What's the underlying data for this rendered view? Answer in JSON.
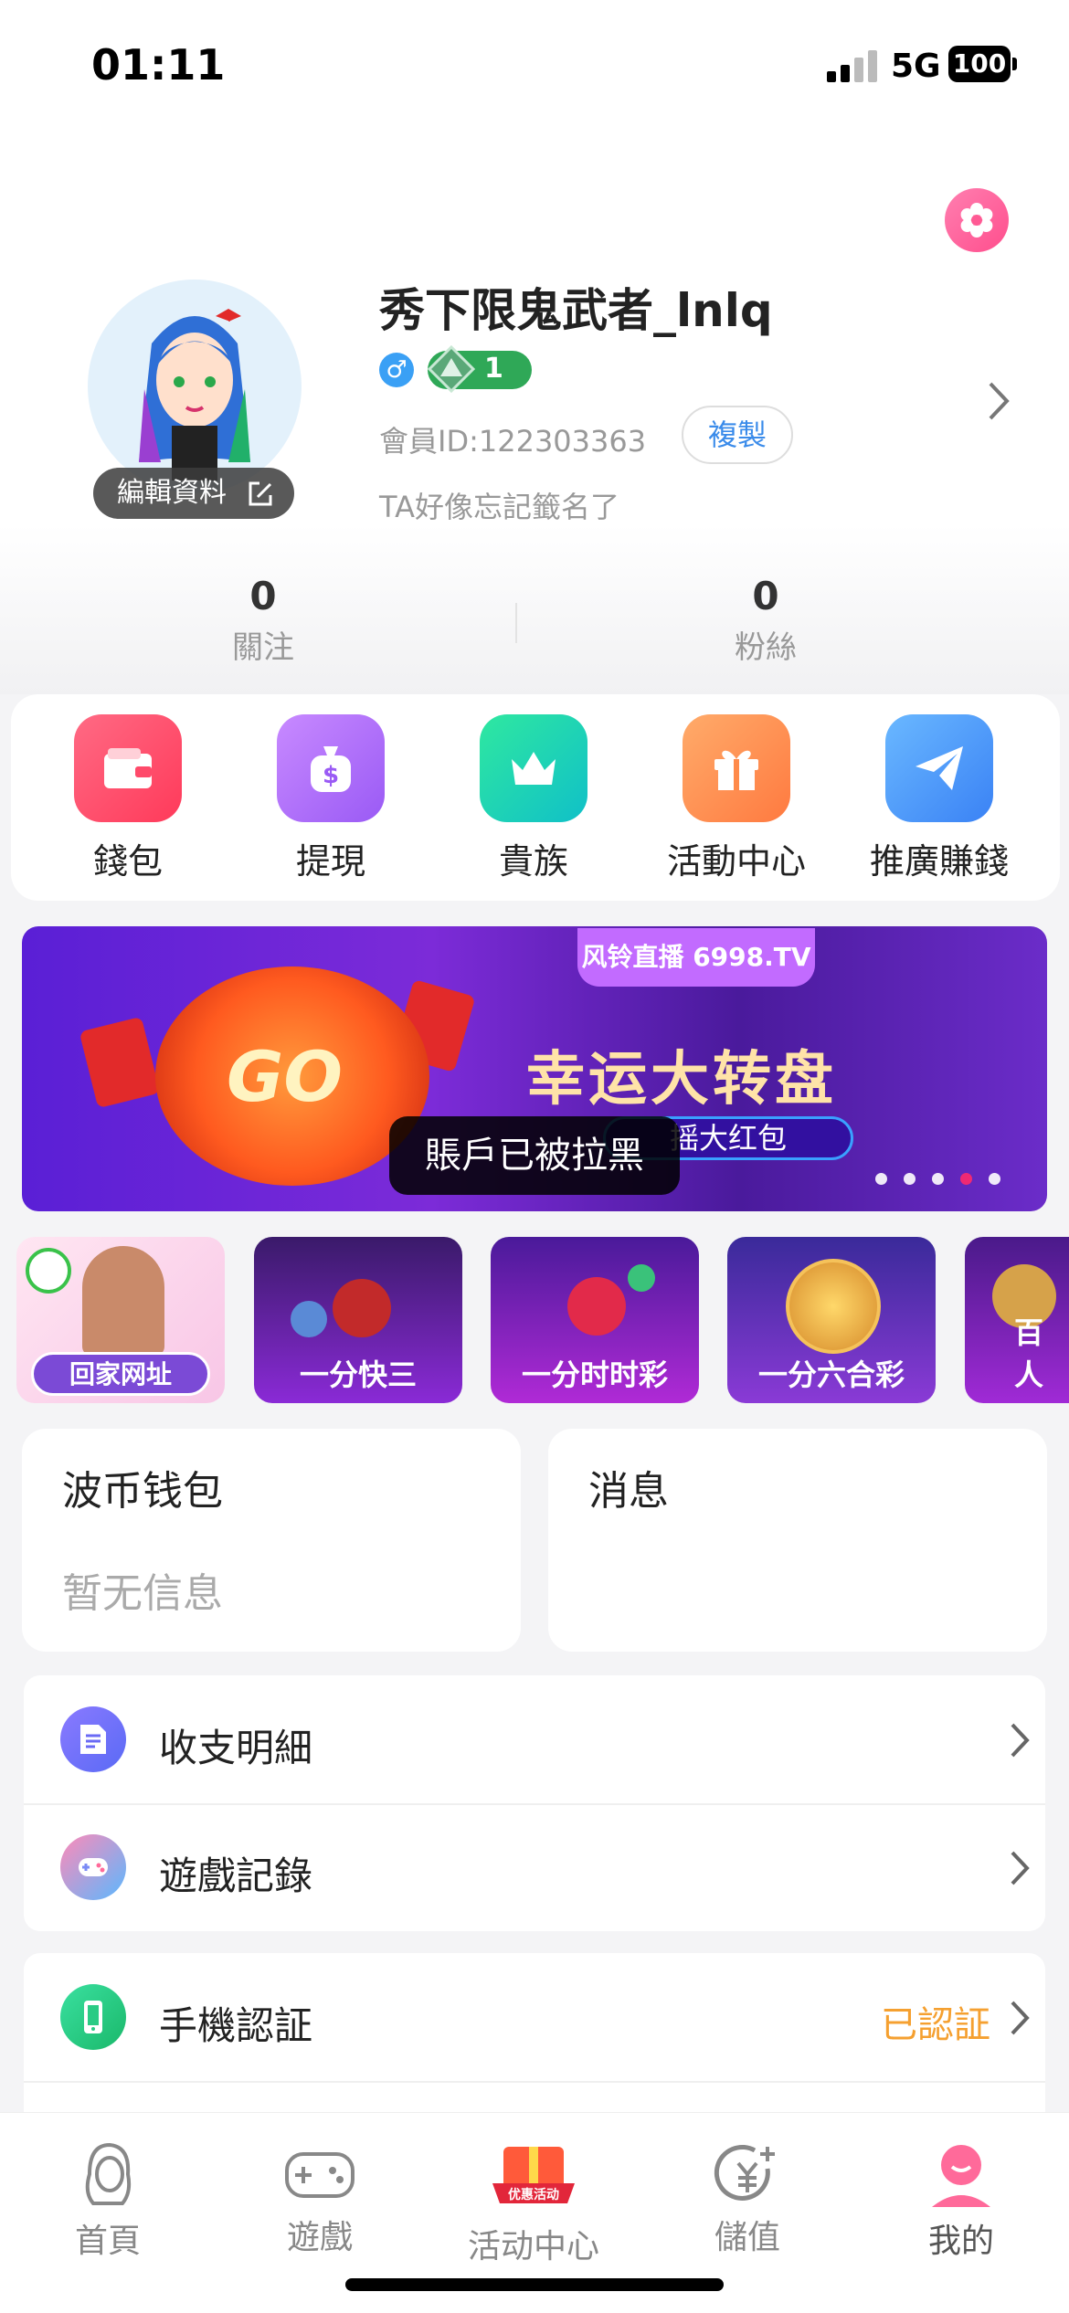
{
  "status_bar": {
    "time": "01:11",
    "network": "5G",
    "battery": "100"
  },
  "profile": {
    "nickname": "秀下限鬼武者_lnlq",
    "gender_symbol": "♂",
    "level": "1",
    "member_id": "會員ID:122303363",
    "copy_label": "複製",
    "signature": "TA好像忘記籤名了",
    "edit_label": "編輯資料"
  },
  "stats": [
    {
      "value": "0",
      "label": "關注"
    },
    {
      "value": "0",
      "label": "粉絲"
    }
  ],
  "quick_actions": [
    {
      "label": "錢包",
      "icon": "wallet-icon",
      "color": "#ff4a6a"
    },
    {
      "label": "提現",
      "icon": "money-bag-icon",
      "color": "#b36bff"
    },
    {
      "label": "貴族",
      "icon": "crown-icon",
      "color": "#1fd6b0"
    },
    {
      "label": "活動中心",
      "icon": "gift-icon",
      "color": "#ff8a4a"
    },
    {
      "label": "推廣賺錢",
      "icon": "paper-plane-icon",
      "color": "#4a9aff"
    }
  ],
  "banner": {
    "title": "幸运大转盘",
    "subtitle": "摇大红包",
    "logo_text": "风铃直播 6998.TV",
    "wheel_text": "GO",
    "active_dot": 3,
    "dot_count": 5
  },
  "toast": "賬戶已被拉黑",
  "game_tiles": [
    {
      "label": "回家网址"
    },
    {
      "label": "一分快三"
    },
    {
      "label": "一分时时彩"
    },
    {
      "label": "一分六合彩"
    },
    {
      "label": "百人"
    }
  ],
  "wallet_card": {
    "title": "波币钱包",
    "subtitle": "暂无信息"
  },
  "message_card": {
    "title": "消息"
  },
  "list_rows": [
    {
      "label": "收支明細",
      "icon": "document-icon"
    },
    {
      "label": "遊戲記錄",
      "icon": "gamepad-icon"
    },
    {
      "label": "手機認証",
      "icon": "phone-icon",
      "status": "已認証"
    }
  ],
  "bottom_nav": [
    {
      "label": "首頁",
      "icon": "girl-avatar-icon"
    },
    {
      "label": "遊戲",
      "icon": "gamepad-icon"
    },
    {
      "label": "活动中心",
      "icon": "promo-gift-icon",
      "badge": "优惠活动"
    },
    {
      "label": "儲值",
      "icon": "yuan-plus-icon"
    },
    {
      "label": "我的",
      "icon": "user-icon",
      "active": true
    }
  ]
}
